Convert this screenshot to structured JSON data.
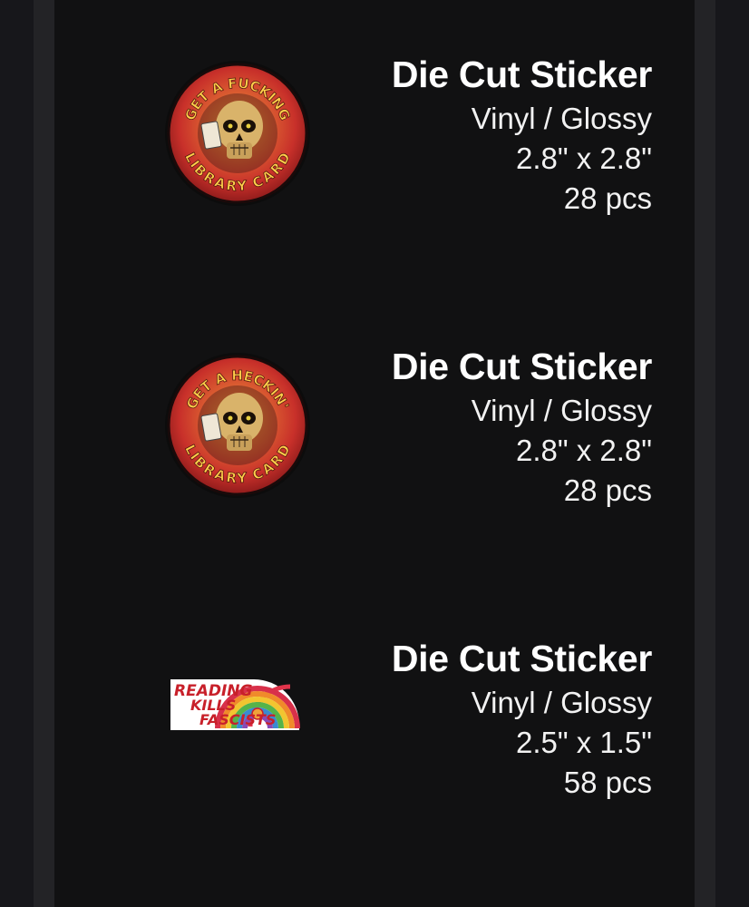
{
  "items": [
    {
      "title": "Die Cut Sticker",
      "material": "Vinyl / Glossy",
      "size": "2.8\" x 2.8\"",
      "quantity": "28 pcs",
      "image": {
        "top_text": "GET A FUCKING",
        "bottom_text": "LIBRARY CARD",
        "icon": "skull-sticker-icon"
      }
    },
    {
      "title": "Die Cut Sticker",
      "material": "Vinyl / Glossy",
      "size": "2.8\" x 2.8\"",
      "quantity": "28 pcs",
      "image": {
        "top_text": "GET A HECKIN'",
        "bottom_text": "LIBRARY CARD",
        "icon": "skull-sticker-icon"
      }
    },
    {
      "title": "Die Cut Sticker",
      "material": "Vinyl / Glossy",
      "size": "2.5\" x 1.5\"",
      "quantity": "58 pcs",
      "image": {
        "line1": "READING",
        "line2": "KILLS",
        "line3": "FASCISTS",
        "icon": "rainbow-sticker-icon"
      }
    }
  ],
  "colors": {
    "background": "#111112",
    "rail": "#232326",
    "text": "#ffffff",
    "sticker_red": "#c8202a",
    "sticker_orange": "#f0a23a",
    "skull": "#d9b36a"
  }
}
